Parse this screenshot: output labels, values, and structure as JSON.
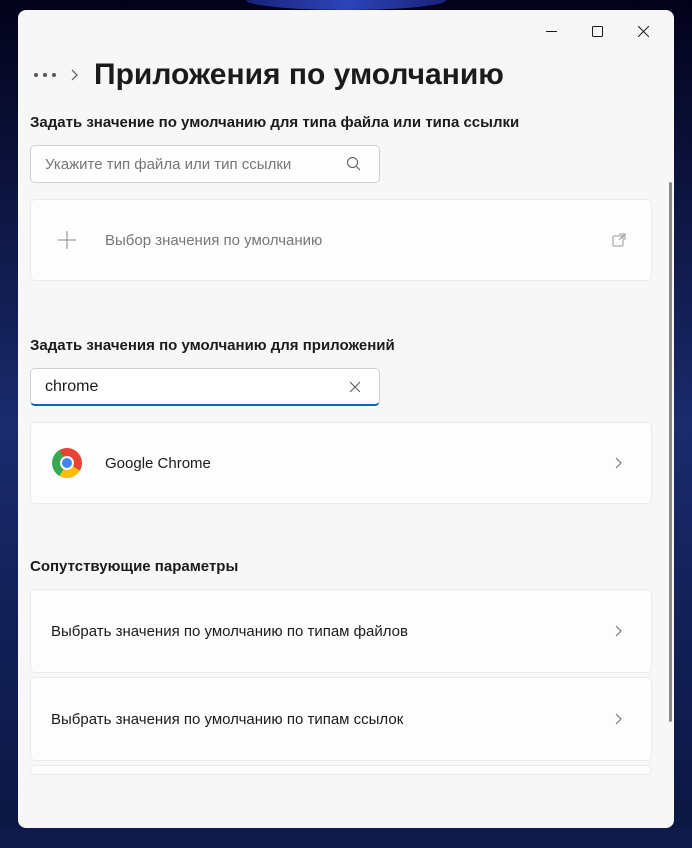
{
  "page": {
    "title": "Приложения по умолчанию"
  },
  "sections": {
    "file_type": {
      "label": "Задать значение по умолчанию для типа файла или типа ссылки",
      "placeholder": "Укажите тип файла или тип ссылки",
      "card_label": "Выбор значения по умолчанию"
    },
    "apps": {
      "label": "Задать значения по умолчанию для приложений",
      "search_value": "chrome",
      "result": "Google Chrome"
    },
    "related": {
      "label": "Сопутствующие параметры",
      "item1": "Выбрать значения по умолчанию по типам файлов",
      "item2": "Выбрать значения по умолчанию по типам ссылок"
    }
  }
}
